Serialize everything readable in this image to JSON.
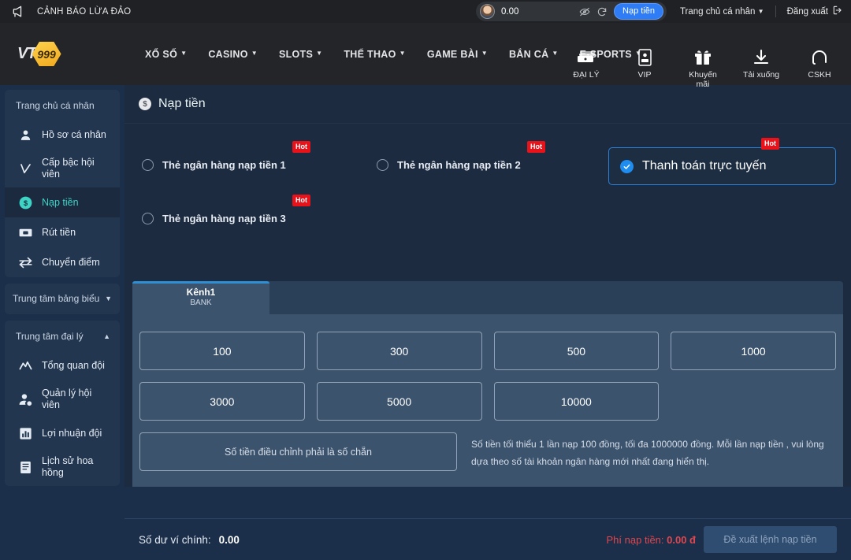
{
  "alert_bar": {
    "icon": "megaphone-icon",
    "text": "CẢNH BÁO LỪA ĐẢO"
  },
  "account_pill": {
    "avatar": "user-avatar",
    "balance": "0.00",
    "eye_icon": "eye-off-icon",
    "refresh_icon": "refresh-icon",
    "deposit_label": "Nạp tiền"
  },
  "top_right": {
    "personal_home": "Trang chủ cá nhân",
    "logout": "Đăng xuất",
    "logout_icon": "logout-icon"
  },
  "brand": {
    "vt": "VT",
    "num": "999"
  },
  "nav": {
    "links": [
      {
        "label": "XỔ SỐ",
        "caret": "▼"
      },
      {
        "label": "CASINO",
        "caret": "▼"
      },
      {
        "label": "SLOTS",
        "caret": "▼"
      },
      {
        "label": "THỂ THAO",
        "caret": "▼"
      },
      {
        "label": "GAME BÀI",
        "caret": "▼"
      },
      {
        "label": "BẮN CÁ",
        "caret": "▼"
      },
      {
        "label": "E-SPORTS",
        "caret": "▼"
      }
    ],
    "icons": [
      {
        "name": "money-stack-icon",
        "label": "ĐẠI LÝ"
      },
      {
        "name": "vip-card-icon",
        "label": "VIP"
      },
      {
        "name": "gift-icon",
        "label": "Khuyến mãi"
      },
      {
        "name": "download-icon",
        "label": "Tải xuống"
      },
      {
        "name": "headset-icon",
        "label": "CSKH"
      }
    ]
  },
  "sidebar": {
    "groups": [
      {
        "title": "Trang chủ cá nhân",
        "collapsible": false,
        "items": [
          {
            "icon": "user-icon",
            "label": "Hồ sơ cá nhân",
            "active": false
          },
          {
            "icon": "vip-rank-icon",
            "label": "Cấp bậc hội viên",
            "active": false
          },
          {
            "icon": "deposit-icon",
            "label": "Nạp tiền",
            "active": true
          },
          {
            "icon": "withdraw-icon",
            "label": "Rút tiền",
            "active": false
          },
          {
            "icon": "transfer-icon",
            "label": "Chuyển điểm",
            "active": false
          }
        ]
      },
      {
        "title": "Trung tâm bảng biểu",
        "collapsible": true,
        "arrow": "▼",
        "items": []
      },
      {
        "title": "Trung tâm đại lý",
        "collapsible": true,
        "arrow": "▲",
        "items": [
          {
            "icon": "trend-chart-icon",
            "label": "Tổng quan đội",
            "active": false
          },
          {
            "icon": "manage-user-icon",
            "label": "Quản lý hội viên",
            "active": false
          },
          {
            "icon": "bar-chart-icon",
            "label": "Lợi nhuận đội",
            "active": false
          },
          {
            "icon": "history-list-icon",
            "label": "Lịch sử hoa hồng",
            "active": false
          }
        ]
      }
    ]
  },
  "main": {
    "title": "Nạp tiền",
    "title_icon": "coin-icon",
    "methods": [
      {
        "label": "Thẻ ngân hàng nạp tiền 1",
        "badge": "Hot",
        "selected": false
      },
      {
        "label": "Thẻ ngân hàng nạp tiền 2",
        "badge": "Hot",
        "selected": false
      },
      {
        "label": "Thẻ ngân hàng nạp tiền 3",
        "badge": "Hot",
        "selected": false
      },
      {
        "label": "Thanh toán trực tuyến",
        "badge": "Hot",
        "selected": true
      }
    ],
    "tab": {
      "name": "Kênh1",
      "sub": "BANK"
    },
    "amounts": [
      "100",
      "300",
      "500",
      "1000",
      "3000",
      "5000",
      "10000"
    ],
    "amount_input_placeholder": "Số tiền điều chỉnh phải là số chẵn",
    "amount_input_value": "",
    "hint": "Số tiền tối thiểu 1 lần nạp 100 đồng, tối đa 1000000 đồng. Mỗi lần nạp tiền , vui lòng dựa theo số tài khoản ngân hàng mới nhất đang hiển thị."
  },
  "footer": {
    "balance_label": "Số dư ví chính:",
    "balance_value": "0.00",
    "fee_label": "Phí nạp tiền:",
    "fee_value": "0.00 đ",
    "submit_label": "Đề xuất lệnh nạp tiền"
  },
  "colors": {
    "accent_blue": "#2f7df6",
    "hot_red": "#e8121b",
    "active_teal": "#3fd3c6",
    "fee_red": "#e0474f",
    "panel_blue": "#3c536d",
    "brand_gold": "#f0a81e"
  }
}
